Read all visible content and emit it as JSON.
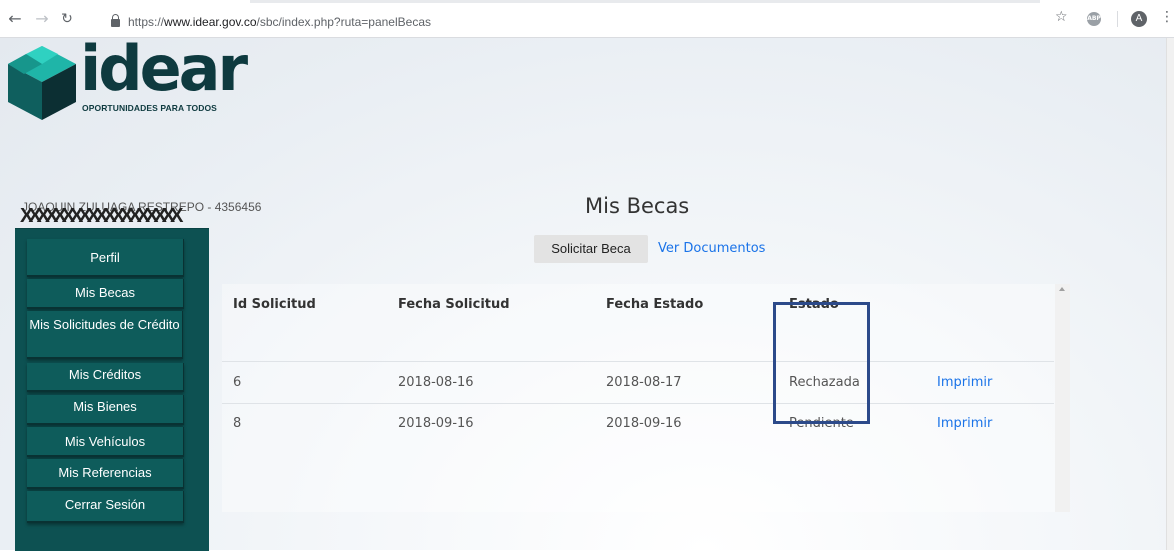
{
  "browser": {
    "url_scheme": "https://",
    "url_host": "www.idear.gov.co",
    "url_path": "/sbc/index.php?ruta=panelBecas",
    "abp_label": "ABP",
    "account_initial": "A"
  },
  "logo": {
    "name": "idear",
    "tagline": "OPORTUNIDADES PARA TODOS"
  },
  "user": {
    "name_line": "JOAQUIN ZULUAGA RESTREPO - 4356456",
    "redaction": "XXXXXXXXXXXXXXXXXXX"
  },
  "sidebar": {
    "items": [
      {
        "label": "Perfil"
      },
      {
        "label": "Mis Becas"
      },
      {
        "label": "Mis Solicitudes de Crédito"
      },
      {
        "label": "Mis Créditos"
      },
      {
        "label": "Mis Bienes"
      },
      {
        "label": "Mis Vehículos"
      },
      {
        "label": "Mis Referencias"
      },
      {
        "label": "Cerrar Sesión"
      }
    ]
  },
  "main": {
    "title": "Mis Becas",
    "request_button": "Solicitar Beca",
    "documents_link": "Ver Documentos"
  },
  "table": {
    "headers": [
      "Id Solicitud",
      "Fecha Solicitud",
      "Fecha Estado",
      "Estado"
    ],
    "rows": [
      {
        "id": "6",
        "fecha_solicitud": "2018-08-16",
        "fecha_estado": "2018-08-17",
        "estado": "Rechazada",
        "action": "Imprimir"
      },
      {
        "id": "8",
        "fecha_solicitud": "2018-09-16",
        "fecha_estado": "2018-09-16",
        "estado": "Pendiente",
        "action": "Imprimir"
      }
    ]
  },
  "colors": {
    "sidebar_bg": "#0d5152",
    "logo": "#0e3a3f",
    "link": "#1a73e8",
    "highlight_box": "#2c4a8a"
  }
}
